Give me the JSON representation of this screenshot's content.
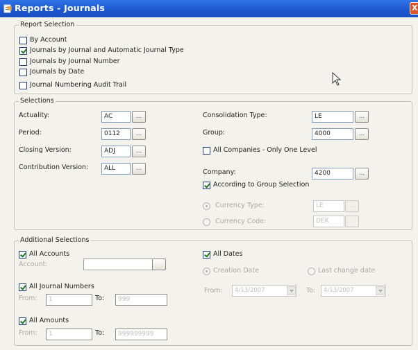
{
  "window": {
    "title": "Reports - Journals",
    "close_label": "X"
  },
  "report_selection": {
    "legend": "Report Selection",
    "options": [
      {
        "label": "By Account",
        "checked": false
      },
      {
        "label": "Journals by Journal and Automatic Journal Type",
        "checked": true
      },
      {
        "label": "Journals by Journal Number",
        "checked": false
      },
      {
        "label": "Journals by Date",
        "checked": false
      },
      {
        "label": "Journal Numbering Audit Trail",
        "checked": false
      }
    ]
  },
  "selections": {
    "legend": "Selections",
    "browse_label": "...",
    "actuality": {
      "label": "Actuality:",
      "value": "AC"
    },
    "period": {
      "label": "Period:",
      "value": "0112"
    },
    "closing_version": {
      "label": "Closing Version:",
      "value": "ADJ"
    },
    "contribution_version": {
      "label": "Contribution Version:",
      "value": "ALL"
    },
    "consolidation_type": {
      "label": "Consolidation Type:",
      "value": "LE"
    },
    "group": {
      "label": "Group:",
      "value": "4000"
    },
    "all_companies": {
      "label": "All Companies - Only One Level",
      "checked": false
    },
    "company": {
      "label": "Company:",
      "value": "4200"
    },
    "according_to_group": {
      "label": "According to Group Selection",
      "checked": true
    },
    "currency_type": {
      "label": "Currency Type:",
      "value": "LE",
      "selected": true
    },
    "currency_code": {
      "label": "Currency Code:",
      "value": "DEK",
      "selected": false
    }
  },
  "additional": {
    "legend": "Additional Selections",
    "all_accounts": {
      "label": "All Accounts",
      "checked": true
    },
    "account": {
      "label": "Account:",
      "value": ""
    },
    "all_journal_numbers": {
      "label": "All Journal Numbers",
      "checked": true
    },
    "journal_from": {
      "label": "From:",
      "value": "1"
    },
    "journal_to": {
      "label": "To:",
      "value": "999"
    },
    "all_amounts": {
      "label": "All Amounts",
      "checked": true
    },
    "amount_from": {
      "label": "From:",
      "value": "1"
    },
    "amount_to": {
      "label": "To:",
      "value": "999999999"
    },
    "all_dates": {
      "label": "All Dates",
      "checked": true
    },
    "creation_date": {
      "label": "Creation Date",
      "selected": true
    },
    "last_change_date": {
      "label": "Last change date",
      "selected": false
    },
    "date_from": {
      "label": "From:",
      "value": "4/13/2007"
    },
    "date_to": {
      "label": "To:",
      "value": "4/13/2007"
    }
  }
}
